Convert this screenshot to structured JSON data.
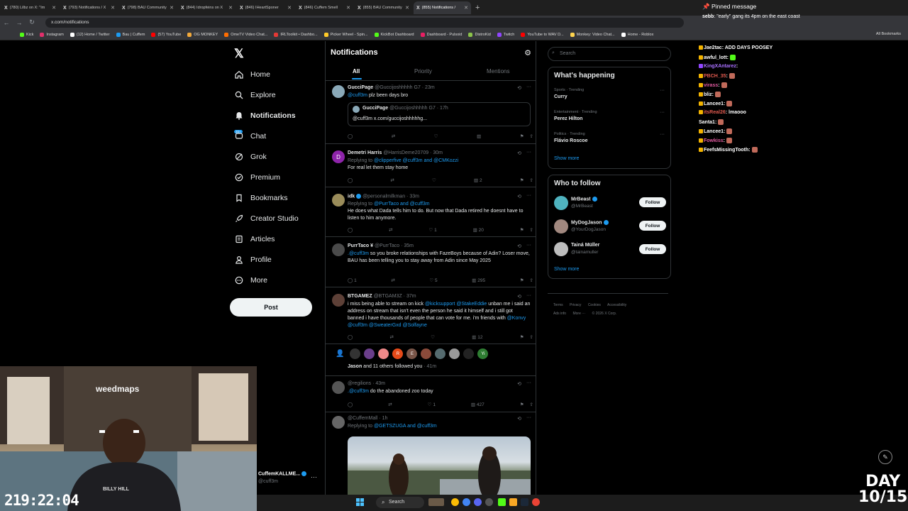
{
  "browser": {
    "tabs": [
      {
        "label": "(780) Lilbz on X: \"Im"
      },
      {
        "label": "(793) Notifications / X"
      },
      {
        "label": "(798) BAU Community"
      },
      {
        "label": "(844) Idropfeins on X"
      },
      {
        "label": "(846) IHeartSponer"
      },
      {
        "label": "(846) Cuffem Smell"
      },
      {
        "label": "(855) BAU Community"
      },
      {
        "label": "(855) Notifications /"
      }
    ],
    "url": "x.com/notifications",
    "bookmarks": [
      {
        "label": "Kick",
        "color": "#53fc18"
      },
      {
        "label": "Instagram",
        "color": "#e1306c"
      },
      {
        "label": "(12) Home / Twitter",
        "color": "#ffffff"
      },
      {
        "label": "Bau | Cuffem",
        "color": "#1d9bf0"
      },
      {
        "label": "(57) YouTube",
        "color": "#ff0000"
      },
      {
        "label": "OG MONKEY",
        "color": "#f2a93b"
      },
      {
        "label": "OmeTV Video Chat...",
        "color": "#ff6d00"
      },
      {
        "label": "IRLToolkit • Dashbo...",
        "color": "#e53935"
      },
      {
        "label": "Picker Wheel - Spin...",
        "color": "#ffca28"
      },
      {
        "label": "KickBot Dashboard",
        "color": "#53fc18"
      },
      {
        "label": "Dashboard - Pulsoid",
        "color": "#e91e63"
      },
      {
        "label": "DistroKid",
        "color": "#8bc34a"
      },
      {
        "label": "Twitch",
        "color": "#9146ff"
      },
      {
        "label": "YouTube to WAV D...",
        "color": "#ff0000"
      },
      {
        "label": "Monkey: Video Chat...",
        "color": "#ffd54f"
      },
      {
        "label": "Home - Roblox",
        "color": "#ffffff"
      }
    ],
    "all_bookmarks": "All Bookmarks"
  },
  "nav": {
    "home": "Home",
    "explore": "Explore",
    "notifications": "Notifications",
    "chat": "Chat",
    "chat_badge": "20+",
    "grok": "Grok",
    "premium": "Premium",
    "bookmarks": "Bookmarks",
    "creator_studio": "Creator Studio",
    "articles": "Articles",
    "profile": "Profile",
    "more": "More",
    "post": "Post"
  },
  "notifications": {
    "title": "Notifications",
    "tabs": [
      "All",
      "Priority",
      "Mentions"
    ],
    "posts": [
      {
        "name": "GucciPage",
        "handle": "@Guccijoshhhhh G7 · 23m",
        "text_prefix": "@cuff3m",
        "text": " plz been days bro",
        "quote_name": "GucciPage",
        "quote_handle": "@Guccijoshhhhh G7 · 17h",
        "quote_text": "@cuff3m x.com/guccijoshhhhhg...",
        "likes": "",
        "views": ""
      },
      {
        "name": "Demetri Harris",
        "handle": "@HarrisDeme20709 · 30m",
        "reply_label": "Replying to ",
        "reply_to": "@clipperfive @cuff3m and @CMKozzi",
        "text": "For real let them stay home",
        "likes": "",
        "views": "2"
      },
      {
        "name": "idk",
        "handle": "@personalmilkman · 33m",
        "reply_label": "Replying to ",
        "reply_to": "@PurrTaco and @cuff3m",
        "text": "He does what Dada tells him to do. But now that Dada retired he doesnt have to listen to him anymore.",
        "likes": "1",
        "views": "20"
      },
      {
        "name": "PurrTaco ¥",
        "handle": "@PurrTaco · 35m",
        "text_prefix": ".@cuff3m",
        "text": " so you broke relationships with FazeBoys because of Adin? Loser move, BAU has been telling you to stay away from Adin since May 2025",
        "replies": "1",
        "likes": "5",
        "views": "295"
      },
      {
        "name": "BTGAMEZ",
        "handle": "@BTGAM3Z · 37m",
        "text_a": "i miss being able to stream on kick ",
        "text_link_a": "@kicksupport @StakeEddie",
        "text_b": " unban me i said an address on stream that isn't even the person he said it himself and i still got banned i have thousands of people that can vote for me. i'm friends with ",
        "text_link_b": "@Konvy @cuff3m @SweaterGxd @Solfayne",
        "likes": "",
        "views": "12"
      },
      {
        "followed_text": "Jason",
        "followed_rest": " and 11 others followed you",
        "followed_time": " · 41m"
      },
      {
        "name": "",
        "handle": "@regilions · 43m",
        "text_prefix": ".@cuff3m",
        "text": " do the abandoned zoo today",
        "likes": "1",
        "views": "427"
      },
      {
        "name": "",
        "handle": "@CuffemMall · 1h",
        "reply_label": "Replying to ",
        "reply_to": "@GETSZUGA and @cuff3m"
      }
    ]
  },
  "right": {
    "search_placeholder": "Search",
    "happening_title": "What's happening",
    "trends": [
      {
        "meta": "Sports · Trending",
        "name": "Curry"
      },
      {
        "meta": "Entertainment · Trending",
        "name": "Perez Hilton"
      },
      {
        "meta": "Politics · Trending",
        "name": "Flávio Roscoe"
      }
    ],
    "show_more": "Show more",
    "wtf_title": "Who to follow",
    "follow_label": "Follow",
    "who_to_follow": [
      {
        "name": "MrBeast",
        "handle": "@MrBeast"
      },
      {
        "name": "MyDogJason",
        "handle": "@YourDogJason"
      },
      {
        "name": "Tainá Müller",
        "handle": "@tainamuller"
      }
    ],
    "footer": [
      "Terms",
      "Privacy",
      "Cookies",
      "Accessibility",
      "Ads info",
      "More ···",
      "© 2026 X Corp."
    ]
  },
  "chat": {
    "pinned": "Pinned message",
    "pinned_user": "sebb",
    "pinned_text": ": \"early\" gang its 4pm on the east coast",
    "lines": [
      {
        "user": "Jae2tac",
        "color": "#ffffff",
        "text": ": ADD DAYS POOSEY"
      },
      {
        "user": "awful_lott",
        "color": "#ffffff",
        "text": ":"
      },
      {
        "user": "KingXAntarez",
        "color": "#9146ff",
        "text": ":"
      },
      {
        "user": "PBCH_35",
        "color": "#e05a4f",
        "text": ":"
      },
      {
        "user": "virass",
        "color": "#e05a9f",
        "text": ":"
      },
      {
        "user": "bliz",
        "color": "#ffffff",
        "text": ":"
      },
      {
        "user": "Lancee1",
        "color": "#ffffff",
        "text": ":"
      },
      {
        "user": "itsReal26",
        "color": "#e05a4f",
        "text": ": lmaooo"
      },
      {
        "user": "Santa1",
        "color": "#ffffff",
        "text": ":"
      },
      {
        "user": "Lancee1",
        "color": "#ffffff",
        "text": ":"
      },
      {
        "user": "Fowkiss",
        "color": "#e05a9f",
        "text": ":"
      },
      {
        "user": "FeefsMissingTooth",
        "color": "#ffffff",
        "text": ":"
      }
    ]
  },
  "stream": {
    "timer": "219:22:04",
    "day_label": "DAY",
    "day_value": "10/15",
    "webcam_text": "weedmaps",
    "shirt_text": "BILLY HILL"
  },
  "profile": {
    "name": "CuffemKALLME...",
    "handle": "@cuff3m"
  },
  "taskbar": {
    "search": "Search"
  }
}
